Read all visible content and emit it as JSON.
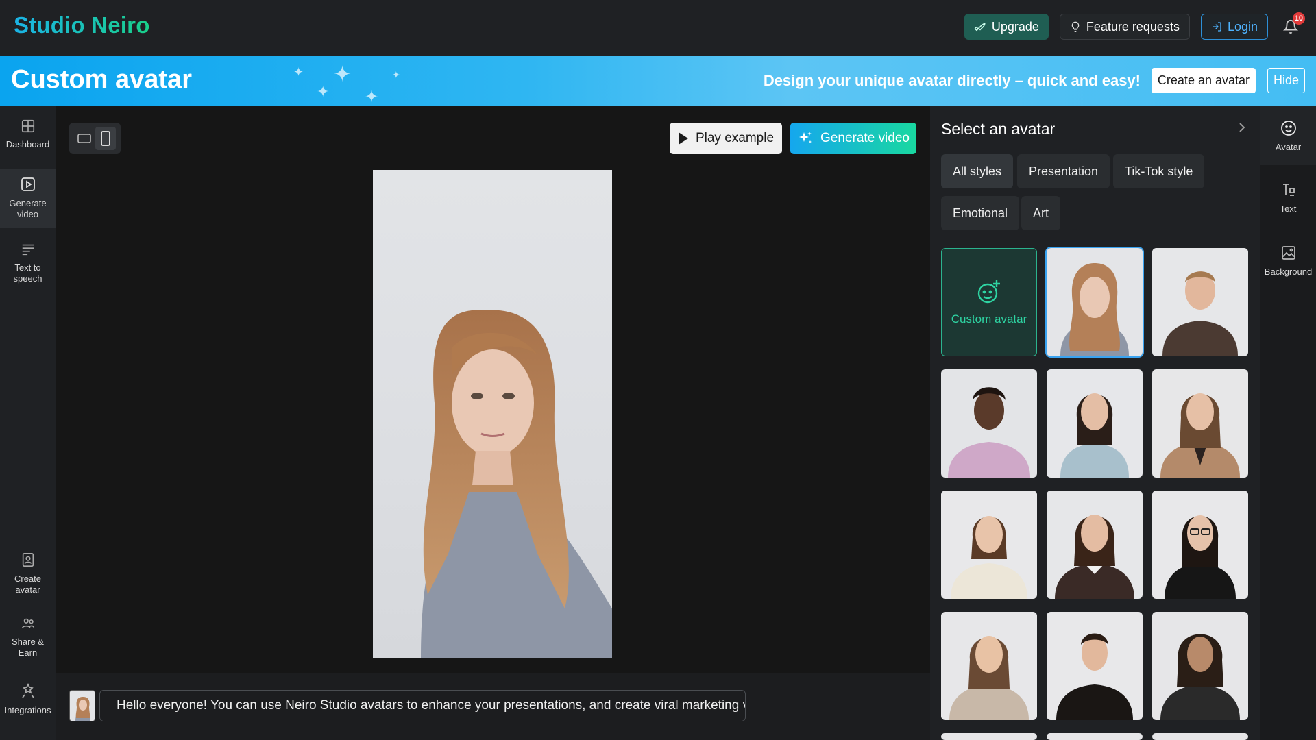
{
  "app": {
    "brand": "Studio Neiro"
  },
  "topbar": {
    "upgrade_label": "Upgrade",
    "feature_label": "Feature requests",
    "login_label": "Login",
    "notification_count": "10"
  },
  "banner": {
    "title": "Custom avatar",
    "tagline": "Design your unique avatar directly – quick and easy!",
    "create_label": "Create an avatar",
    "hide_label": "Hide"
  },
  "sidebar": {
    "items": [
      {
        "label": "Dashboard",
        "icon": "dashboard-icon"
      },
      {
        "label": "Generate video",
        "icon": "play-square-icon",
        "active": true
      },
      {
        "label": "Text to speech",
        "icon": "lines-icon"
      },
      {
        "label": "Create avatar",
        "icon": "portrait-icon"
      },
      {
        "label": "Share & Earn",
        "icon": "users-icon"
      },
      {
        "label": "Integrations",
        "icon": "puzzle-icon"
      }
    ]
  },
  "main": {
    "play_label": "Play example",
    "generate_label": "Generate video",
    "orientation_selected": "portrait"
  },
  "script": {
    "text": "Hello everyone! You can use Neiro Studio avatars to enhance your presentations, and create viral marketing videos!"
  },
  "panel": {
    "title": "Select an avatar",
    "filters": [
      "All styles",
      "Presentation",
      "Tik-Tok style",
      "Emotional",
      "Art"
    ],
    "selected_filter": "All styles",
    "custom_label": "Custom avatar"
  },
  "tools": {
    "items": [
      {
        "label": "Avatar",
        "icon": "smiley-icon",
        "active": true
      },
      {
        "label": "Text",
        "icon": "text-tool-icon"
      },
      {
        "label": "Background",
        "icon": "image-icon"
      }
    ]
  },
  "colors": {
    "accent_blue": "#15a7ee",
    "accent_green": "#19d08a",
    "badge_red": "#e23b3b"
  }
}
